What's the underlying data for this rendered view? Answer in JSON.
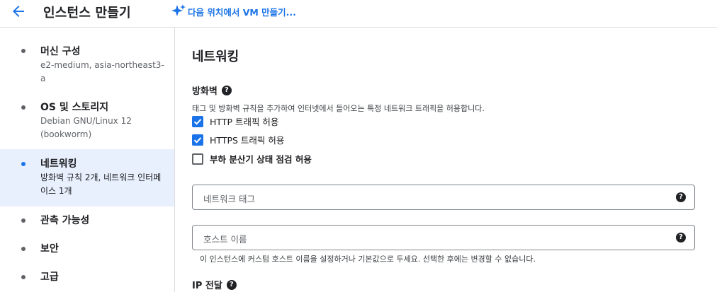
{
  "header": {
    "title": "인스턴스 만들기",
    "ai_link": "다음 위치에서 VM 만들기..."
  },
  "sidebar": {
    "items": [
      {
        "label": "머신 구성",
        "sub": "e2-medium, asia-northeast3-a",
        "active": false
      },
      {
        "label": "OS 및 스토리지",
        "sub": "Debian GNU/Linux 12 (bookworm)",
        "active": false
      },
      {
        "label": "네트워킹",
        "sub": "방화벽 규칙 2개, 네트워크 인터페이스 1개",
        "active": true
      },
      {
        "label": "관측 가능성",
        "sub": "",
        "active": false
      },
      {
        "label": "보안",
        "sub": "",
        "active": false
      },
      {
        "label": "고급",
        "sub": "",
        "active": false
      }
    ]
  },
  "main": {
    "heading": "네트워킹",
    "firewall": {
      "title": "방화벽",
      "description": "태그 및 방화벽 규칙을 추가하여 인터넷에서 들어오는 특정 네트워크 트래픽을 허용합니다.",
      "options": [
        {
          "label": "HTTP 트래픽 허용",
          "checked": true
        },
        {
          "label": "HTTPS 트래픽 허용",
          "checked": true
        },
        {
          "label": "부하 분산기 상태 점검 허용",
          "checked": false
        }
      ]
    },
    "network_tags": {
      "placeholder": "네트워크 태그"
    },
    "hostname": {
      "placeholder": "호스트 이름",
      "hint": "이 인스턴스에 커스텀 호스트 이름을 설정하거나 기본값으로 두세요. 선택한 후에는 변경할 수 없습니다."
    },
    "ip_forwarding": {
      "title": "IP 전달"
    }
  },
  "colors": {
    "accent": "#1a73e8",
    "active_bg": "#e8f0fe",
    "border": "#dadce0"
  }
}
